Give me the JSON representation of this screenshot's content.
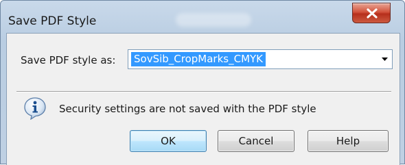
{
  "window": {
    "title": "Save PDF Style",
    "close_icon": "close-x-icon"
  },
  "form": {
    "label": "Save PDF style as:",
    "value": "SovSib_CropMarks_CMYK",
    "dropdown_icon": "chevron-down-icon"
  },
  "info": {
    "icon": "info-icon",
    "message": "Security settings are not saved with the PDF style"
  },
  "buttons": {
    "ok": "OK",
    "cancel": "Cancel",
    "help": "Help"
  },
  "colors": {
    "selection": "#3399ff",
    "close_button": "#c9432d",
    "default_button_border": "#3c7fb1",
    "titlebar": "#c2d5e8"
  }
}
